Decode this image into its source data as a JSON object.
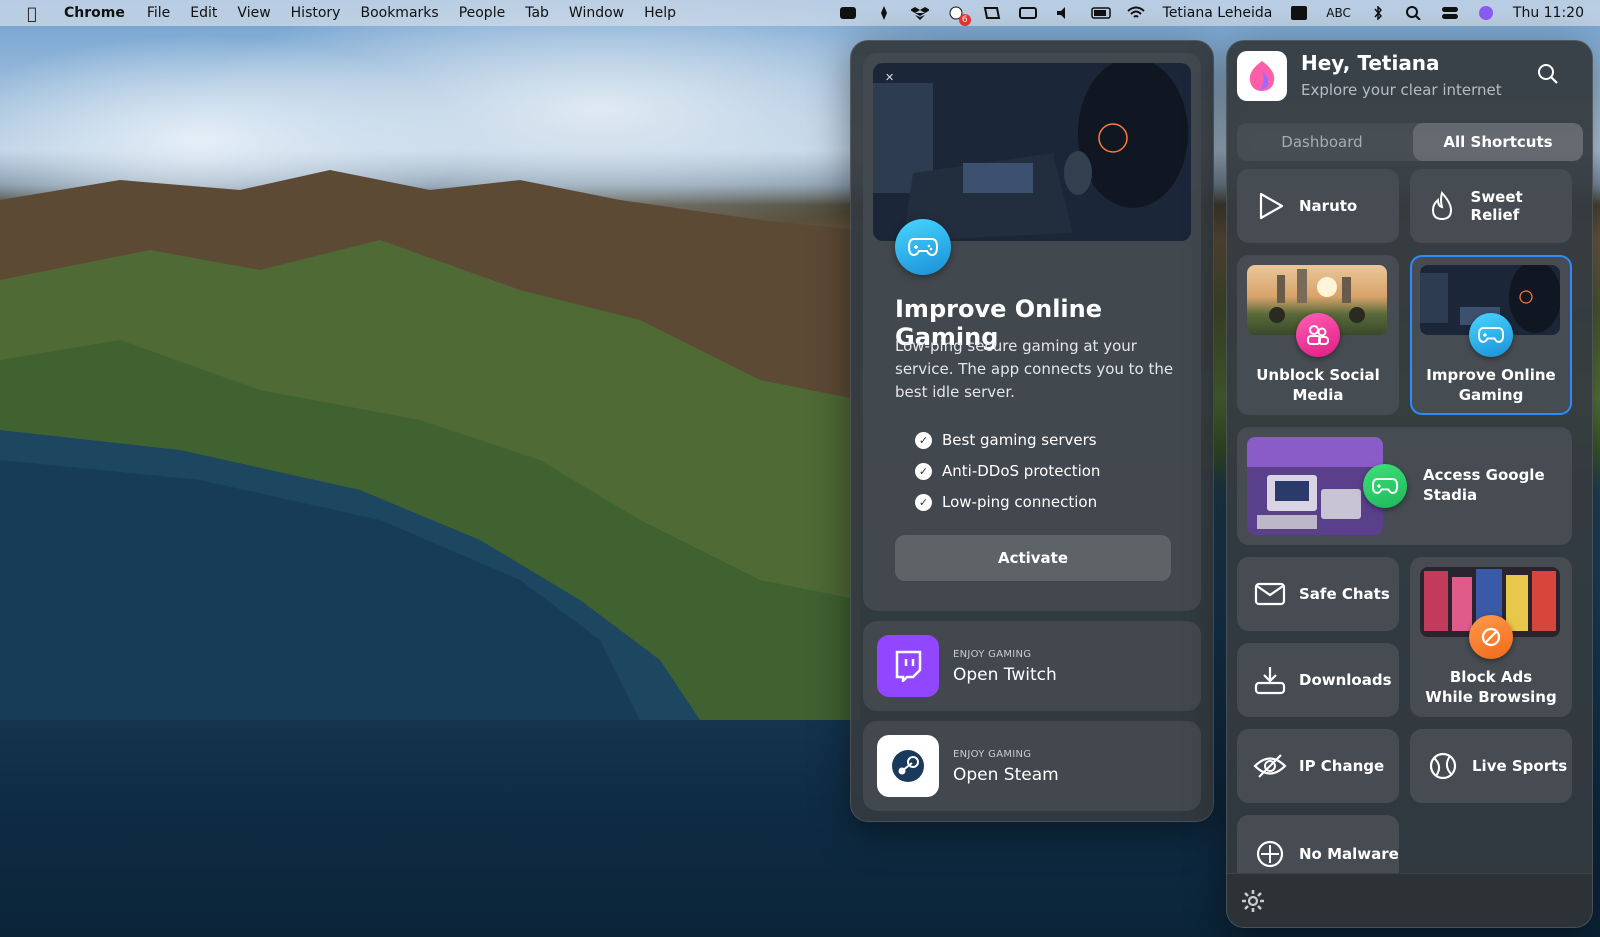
{
  "menubar": {
    "app": "Chrome",
    "items": [
      "File",
      "Edit",
      "View",
      "History",
      "Bookmarks",
      "People",
      "Tab",
      "Window",
      "Help"
    ],
    "badge_count": "6",
    "user": "Tetiana Leheida",
    "input_source": "ABC",
    "clock": "Thu 11:20"
  },
  "feature": {
    "title": "Improve Online Gaming",
    "description": "Low-ping secure gaming at your service. The app connects you to the best idle server.",
    "features": [
      "Best gaming servers",
      "Anti-DDoS protection",
      "Low-ping connection"
    ],
    "activate_label": "Activate"
  },
  "enjoy": [
    {
      "small": "ENJOY GAMING",
      "label": "Open Twitch",
      "icon": "twitch-icon",
      "color": "#9146ff"
    },
    {
      "small": "ENJOY GAMING",
      "label": "Open Steam",
      "icon": "steam-icon",
      "color": "#ffffff"
    }
  ],
  "header": {
    "greeting": "Hey, Tetiana",
    "subtitle": "Explore your clear internet"
  },
  "tabs": {
    "dashboard": "Dashboard",
    "all_shortcuts": "All Shortcuts",
    "active": "All Shortcuts"
  },
  "shortcuts": {
    "naruto": "Naruto",
    "sweet_relief": "Sweet Relief",
    "unblock_social": "Unblock Social Media",
    "improve_gaming": "Improve Online Gaming",
    "google_stadia": "Access Google Stadia",
    "safe_chats": "Safe Chats",
    "block_ads": "Block Ads While Browsing",
    "downloads": "Downloads",
    "ip_change": "IP Change",
    "live_sports": "Live Sports",
    "no_malware": "No Malware"
  },
  "colors": {
    "accent_blue": "#2b8cff",
    "gaming_badge": "#1a8fd8",
    "social_badge": "#ff3f9e",
    "stadia_badge": "#2bd56a",
    "ads_badge": "#ff7a2a",
    "twitch": "#9146ff"
  }
}
